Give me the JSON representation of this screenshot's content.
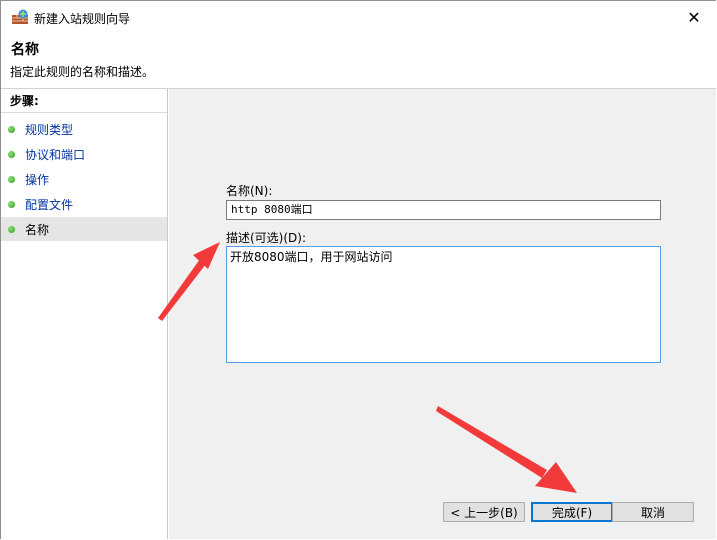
{
  "window": {
    "title": "新建入站规则向导",
    "close_glyph": "✕"
  },
  "header": {
    "title": "名称",
    "description": "指定此规则的名称和描述。"
  },
  "sidebar": {
    "title": "步骤:",
    "items": [
      {
        "label": "规则类型"
      },
      {
        "label": "协议和端口"
      },
      {
        "label": "操作"
      },
      {
        "label": "配置文件"
      },
      {
        "label": "名称"
      }
    ]
  },
  "form": {
    "name_label": "名称(N):",
    "name_value": "http 8080端口",
    "desc_label": "描述(可选)(D):",
    "desc_value": "开放8080端口，用于网站访问"
  },
  "buttons": {
    "back": "< 上一步(B)",
    "finish": "完成(F)",
    "cancel": "取消"
  },
  "colors": {
    "annotation_arrow": "#f23a3a",
    "step_link": "#0033a0",
    "focus_border": "#569de5"
  }
}
